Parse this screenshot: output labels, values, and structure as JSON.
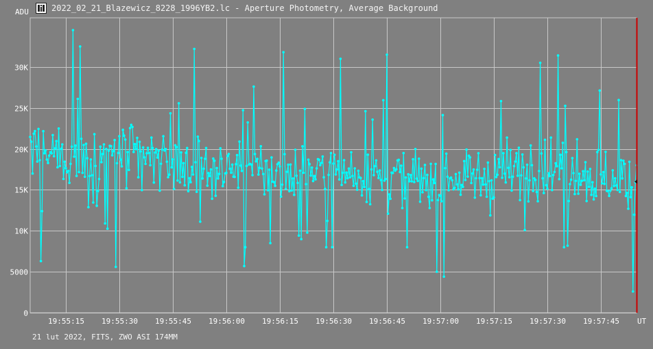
{
  "window": {
    "title": "2022_02_21_Blazewicz_8228_1996YB2.lc - Aperture Photometry, Average Background",
    "footer": "21 lut 2022, FITS, ZWO ASI 174MM"
  },
  "colors": {
    "background": "#808080",
    "grid": "#c8c8c8",
    "series": "#00ffff",
    "marker": "#cc0000",
    "text": "#ffffff"
  },
  "chart_data": {
    "type": "line",
    "ylabel": "ADU",
    "xlabel": "UT",
    "ylim": [
      0,
      36000
    ],
    "xlim": [
      "19:55:05",
      "19:57:55"
    ],
    "grid": true,
    "y_ticks": [
      "0",
      "5000",
      "10K",
      "15K",
      "20K",
      "25K",
      "30K"
    ],
    "y_tick_values": [
      0,
      5000,
      10000,
      15000,
      20000,
      25000,
      30000
    ],
    "x_ticks": [
      "19:55:15",
      "19:55:30",
      "19:55:45",
      "19:56:00",
      "19:56:15",
      "19:56:30",
      "19:56:45",
      "19:57:00",
      "19:57:15",
      "19:57:30",
      "19:57:45"
    ],
    "series": [
      {
        "sampling": "approximately 3 samples per second",
        "x_start": "19:55:05",
        "x_end": "19:57:55",
        "mean_profile": [
          {
            "x": "19:55:05",
            "y": 20000
          },
          {
            "x": "19:55:20",
            "y": 18500
          },
          {
            "x": "19:55:30",
            "y": 19500
          },
          {
            "x": "19:55:45",
            "y": 18000
          },
          {
            "x": "19:56:00",
            "y": 17500
          },
          {
            "x": "19:56:15",
            "y": 17000
          },
          {
            "x": "19:56:30",
            "y": 17500
          },
          {
            "x": "19:56:45",
            "y": 16500
          },
          {
            "x": "19:57:00",
            "y": 16000
          },
          {
            "x": "19:57:15",
            "y": 17000
          },
          {
            "x": "19:57:30",
            "y": 18000
          },
          {
            "x": "19:57:45",
            "y": 16500
          },
          {
            "x": "19:57:55",
            "y": 16000
          }
        ],
        "typical_range": [
          10000,
          25000
        ],
        "notable_points": [
          {
            "x": "19:55:08",
            "y": 6300
          },
          {
            "x": "19:55:17",
            "y": 34500
          },
          {
            "x": "19:55:19",
            "y": 32500
          },
          {
            "x": "19:55:29",
            "y": 5600
          },
          {
            "x": "19:55:51",
            "y": 32200
          },
          {
            "x": "19:56:05",
            "y": 5700
          },
          {
            "x": "19:56:16",
            "y": 31800
          },
          {
            "x": "19:56:32",
            "y": 31000
          },
          {
            "x": "19:56:45",
            "y": 31500
          },
          {
            "x": "19:56:59",
            "y": 5000
          },
          {
            "x": "19:57:01",
            "y": 4400
          },
          {
            "x": "19:57:28",
            "y": 30500
          },
          {
            "x": "19:57:33",
            "y": 31400
          },
          {
            "x": "19:57:54",
            "y": 2600
          }
        ]
      }
    ],
    "cursor": {
      "x": "19:57:55",
      "y": 16000
    }
  }
}
